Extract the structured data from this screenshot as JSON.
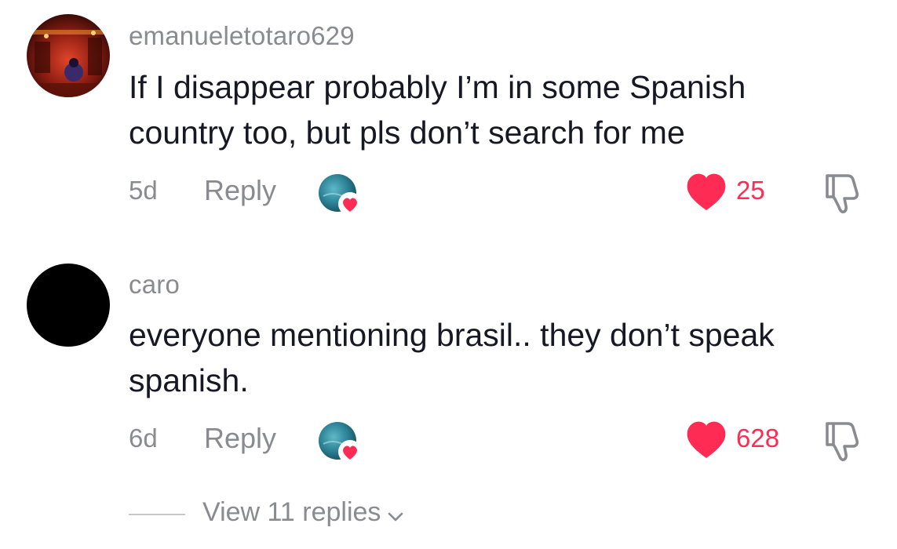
{
  "comments": [
    {
      "username": "emanueletotaro629",
      "text_lines": [
        "If I disappear probably I’m in some Spanish",
        "country too, but pls don’t search for me"
      ],
      "time": "5d",
      "reply_label": "Reply",
      "like_count": "25",
      "avatar_icon": "profile-photo-red-scene"
    },
    {
      "username": "caro",
      "text_lines": [
        "everyone mentioning brasil.. they don’t speak",
        "spanish."
      ],
      "time": "6d",
      "reply_label": "Reply",
      "like_count": "628",
      "avatar_icon": "profile-photo-black"
    }
  ],
  "view_replies": {
    "label": "View 11 replies"
  },
  "icons": {
    "like": "heart-icon",
    "dislike": "thumbs-down-icon",
    "creator_like": "creator-liked-icon",
    "expand": "chevron-down-icon"
  },
  "colors": {
    "accent_red": "#fe2c55",
    "secondary_text": "#8a8b91",
    "primary_text": "#161823"
  }
}
